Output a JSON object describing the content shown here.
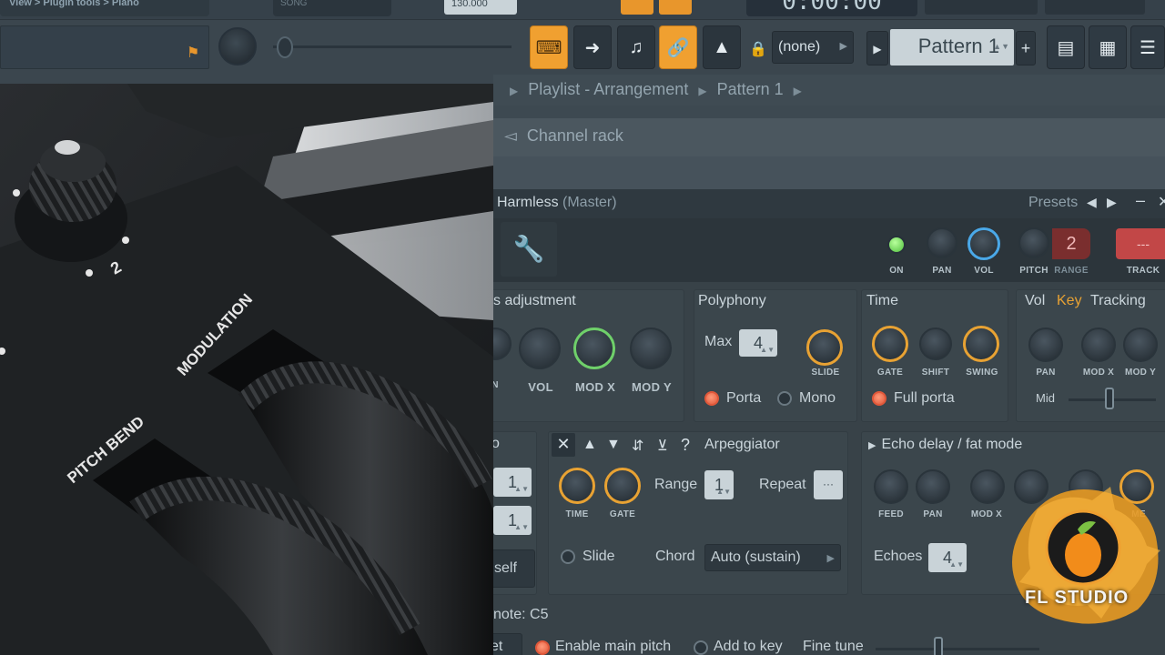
{
  "toolbar": {
    "hint_text": "View > Plugin tools > Piano",
    "song_label": "SONG",
    "tempo": "130.000",
    "time": "0:00:00",
    "pattern_select": "(none)",
    "pattern_name": "Pattern 1",
    "add_label": "+"
  },
  "playlist": {
    "title": "Playlist - Arrangement",
    "pattern": "Pattern 1"
  },
  "channel_rack": {
    "title": "Channel rack"
  },
  "plugin": {
    "name": "Harmless",
    "target": "(Master)",
    "presets_label": "Presets",
    "strip": {
      "on": "ON",
      "pan": "PAN",
      "vol": "VOL",
      "pitch": "PITCH",
      "range_label": "RANGE",
      "range_value": "2",
      "track_label": "TRACK",
      "track_value": "---"
    },
    "misc_adjust": {
      "title": "s adjustment",
      "k1": "N",
      "k2": "VOL",
      "k3": "MOD X",
      "k4": "MOD Y"
    },
    "polyphony": {
      "title": "Polyphony",
      "max_label": "Max",
      "max_value": "4",
      "slide_label": "SLIDE",
      "porta": "Porta",
      "mono": "Mono"
    },
    "time": {
      "title": "Time",
      "gate": "GATE",
      "shift": "SHIFT",
      "swing": "SWING",
      "full_porta": "Full porta"
    },
    "envelope": {
      "tab_vol": "Vol",
      "tab_key": "Key",
      "tab_tracking": "Tracking",
      "pan": "PAN",
      "modx": "MOD X",
      "mody": "MOD Y",
      "mid": "Mid"
    },
    "left_partial": {
      "title": "o",
      "v1": "1",
      "v2": "1",
      "self": "self"
    },
    "arpeggiator": {
      "help": "?",
      "title": "Arpeggiator",
      "time": "TIME",
      "gate": "GATE",
      "range_label": "Range",
      "range_value": "1",
      "repeat_label": "Repeat",
      "repeat_value": "···",
      "slide": "Slide",
      "chord_label": "Chord",
      "chord_value": "Auto (sustain)"
    },
    "echo": {
      "title": "Echo delay / fat mode",
      "feed": "FEED",
      "pan": "PAN",
      "modx": "MOD X",
      "me": "ME",
      "echoes_label": "Echoes",
      "echoes_value": "4"
    },
    "bottom": {
      "note": "note: C5",
      "et": "et",
      "enable_main_pitch": "Enable main pitch",
      "add_to_key": "Add to key",
      "fine_tune": "Fine tune"
    }
  },
  "photo": {
    "pitch_bend": "PITCH BEND",
    "modulation": "MODULATION",
    "knob_mark": "2"
  },
  "logo": {
    "text": "FL STUDIO"
  },
  "colors": {
    "accent_orange": "#f0a030",
    "led_green": "#6fd06a",
    "ring_blue": "#4aa8e8",
    "radio_red": "#e0583a",
    "track_red": "#c24747"
  }
}
